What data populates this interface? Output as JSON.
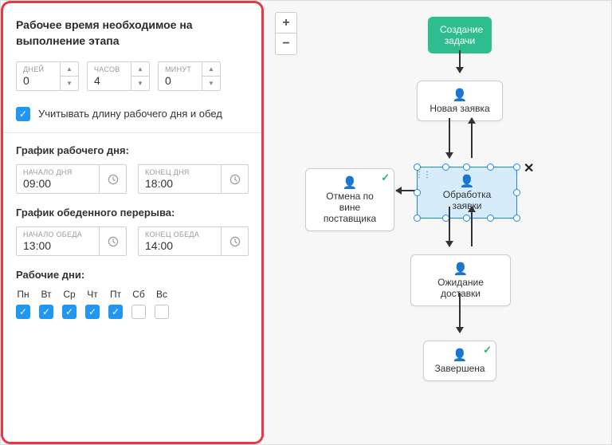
{
  "titles": {
    "work_time": "Рабочее время необходимое на выполнение этапа",
    "schedule_day": "График рабочего дня:",
    "schedule_lunch": "График обеденного перерыва:",
    "work_days": "Рабочие дни:"
  },
  "duration": {
    "days_label": "ДНЕЙ",
    "days_value": "0",
    "hours_label": "ЧАСОВ",
    "hours_value": "4",
    "minutes_label": "МИНУТ",
    "minutes_value": "0"
  },
  "checkbox_consider": "Учитывать длину рабочего дня и обед",
  "day_schedule": {
    "start_label": "НАЧАЛО ДНЯ",
    "start_value": "09:00",
    "end_label": "КОНЕЦ ДНЯ",
    "end_value": "18:00"
  },
  "lunch_schedule": {
    "start_label": "НАЧАЛО ОБЕДА",
    "start_value": "13:00",
    "end_label": "КОНЕЦ ОБЕДА",
    "end_value": "14:00"
  },
  "days": [
    "Пн",
    "Вт",
    "Ср",
    "Чт",
    "Пт",
    "Сб",
    "Вс"
  ],
  "days_checked": [
    true,
    true,
    true,
    true,
    true,
    false,
    false
  ],
  "zoom": {
    "in": "+",
    "out": "−"
  },
  "flow": {
    "start": "Создание задачи",
    "n1": "Новая заявка",
    "n2_left": "Отмена по вине поставщика",
    "n2": "Обработка заявки",
    "n3": "Ожидание доставки",
    "n4": "Завершена"
  }
}
